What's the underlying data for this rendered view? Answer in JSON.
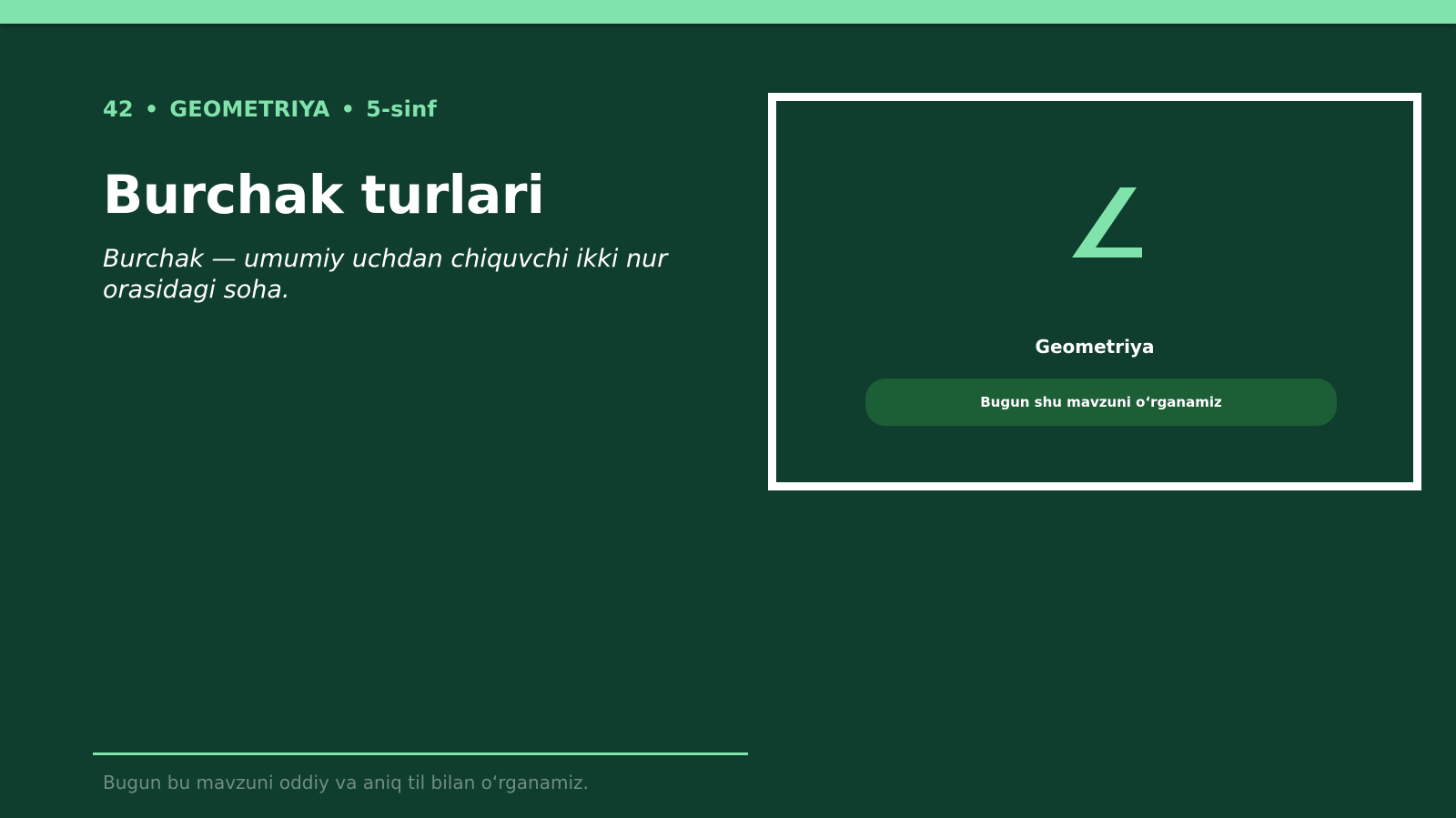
{
  "header": {
    "lesson_number": "42",
    "subject": "GEOMETRIYA",
    "grade": "5-sinf",
    "separator": "•"
  },
  "main": {
    "title": "Burchak turlari",
    "subtitle": "Burchak — umumiy uchdan chiquvchi ikki nur orasidagi soha."
  },
  "card": {
    "icon": "angle-icon",
    "label": "Geometriya",
    "button_label": "Bugun shu mavzuni oʻrganamiz"
  },
  "footer": {
    "text": "Bugun bu mavzuni oddiy va aniq til bilan oʻrganamiz."
  },
  "colors": {
    "background": "#0f3d2e",
    "accent": "#80e3ab",
    "button": "#1c5e36",
    "text": "#ffffff",
    "muted_text": "#6f8e83"
  }
}
